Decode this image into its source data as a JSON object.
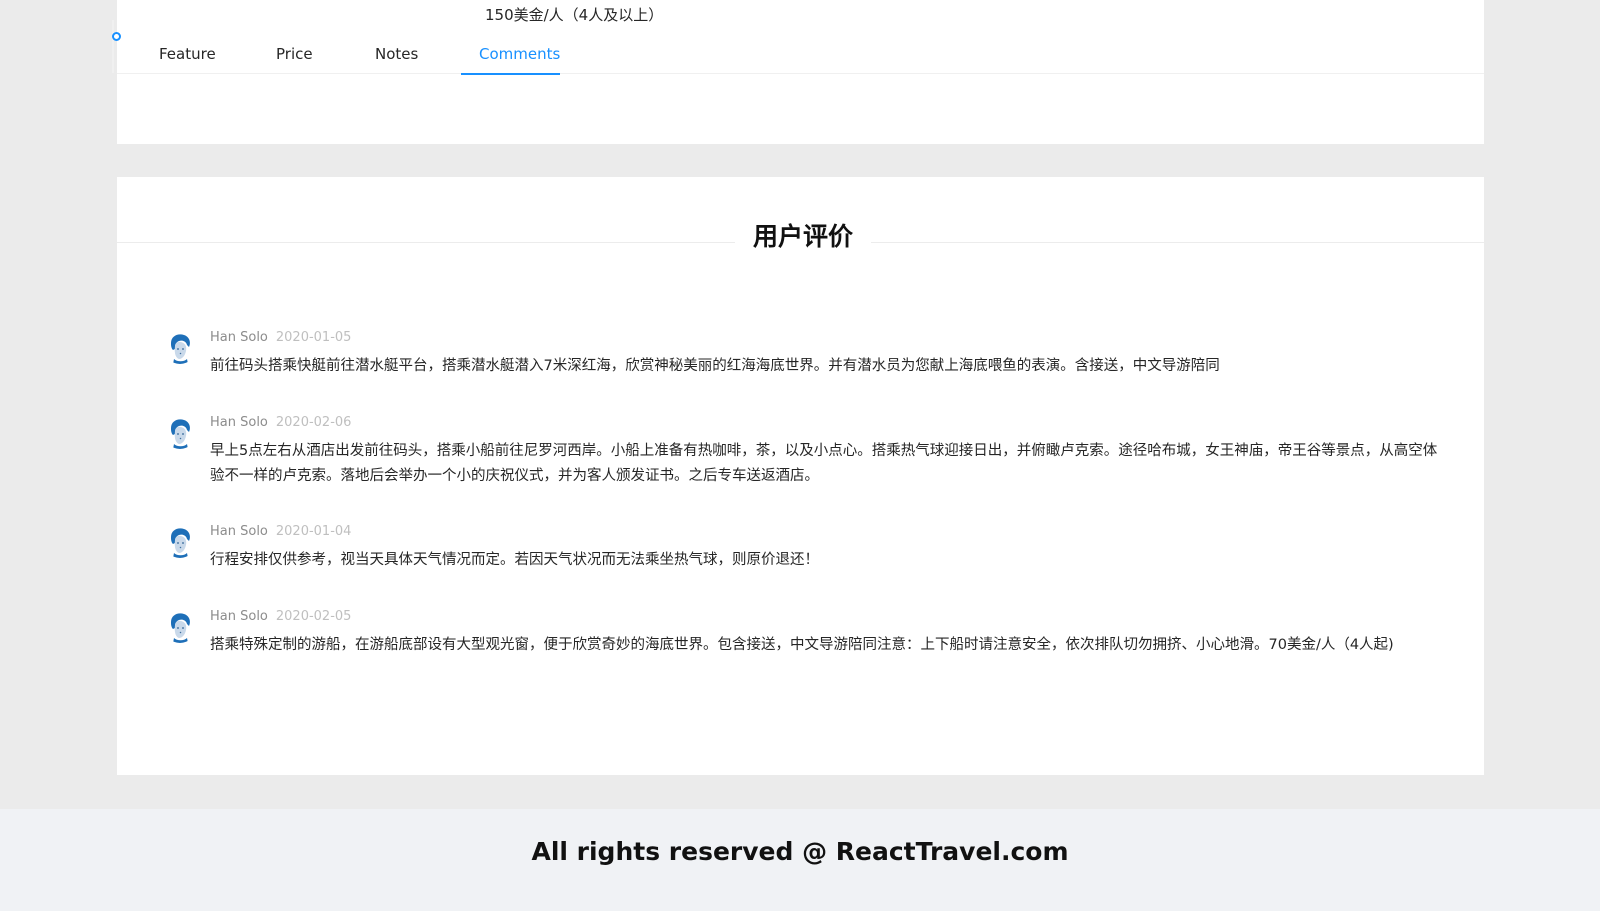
{
  "product": {
    "price_text": "150美金/人（4人及以上）"
  },
  "tabs": [
    {
      "label": "Feature"
    },
    {
      "label": "Price"
    },
    {
      "label": "Notes"
    },
    {
      "label": "Comments",
      "active": true
    }
  ],
  "comments_section": {
    "title": "用户评价",
    "items": [
      {
        "author": "Han Solo",
        "datetime": "2020-01-05",
        "content": "前往码头搭乘快艇前往潜水艇平台，搭乘潜水艇潜入7米深红海，欣赏神秘美丽的红海海底世界。并有潜水员为您献上海底喂鱼的表演。含接送，中文导游陪同"
      },
      {
        "author": "Han Solo",
        "datetime": "2020-02-06",
        "content": "早上5点左右从酒店出发前往码头，搭乘小船前往尼罗河西岸。小船上准备有热咖啡，茶，以及小点心。搭乘热气球迎接日出，并俯瞰卢克索。途径哈布城，女王神庙，帝王谷等景点，从高空体验不一样的卢克索。落地后会举办一个小的庆祝仪式，并为客人颁发证书。之后专车送返酒店。"
      },
      {
        "author": "Han Solo",
        "datetime": "2020-01-04",
        "content": "行程安排仅供参考，视当天具体天气情况而定。若因天气状况而无法乘坐热气球，则原价退还！"
      },
      {
        "author": "Han Solo",
        "datetime": "2020-02-05",
        "content": "搭乘特殊定制的游船，在游船底部设有大型观光窗，便于欣赏奇妙的海底世界。包含接送，中文导游陪同注意：上下船时请注意安全，依次排队切勿拥挤、小心地滑。70美金/人（4人起)"
      }
    ]
  },
  "footer": {
    "text": "All rights reserved @ ReactTravel.com"
  },
  "colors": {
    "accent": "#1890ff",
    "page_bg": "#ebebeb",
    "footer_bg": "#f0f2f5"
  }
}
